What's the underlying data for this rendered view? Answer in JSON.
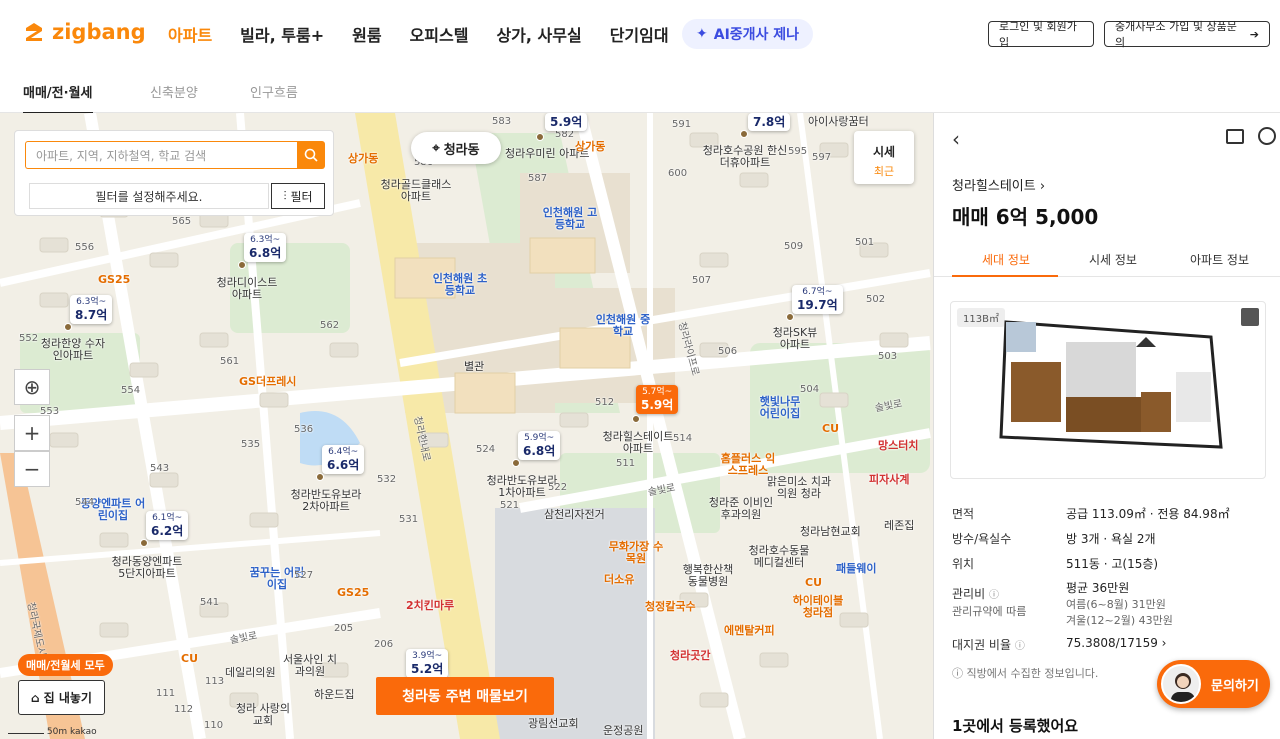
{
  "header": {
    "logo": "zigbang",
    "nav": [
      "아파트",
      "빌라, 투룸+",
      "원룸",
      "오피스텔",
      "상가, 사무실",
      "단기임대"
    ],
    "ai_label": "AI중개사 제나",
    "login_label": "로그인 및 회원가입",
    "agent_label": "중개사무소 가입 및 상품문의"
  },
  "subtabs": [
    "매매/전·월세",
    "신축분양",
    "인구흐름"
  ],
  "search": {
    "placeholder": "아파트, 지역, 지하철역, 학교 검색",
    "filter_msg": "필터를 설정해주세요.",
    "filter_label": "필터"
  },
  "map": {
    "location_label": "청라동",
    "sise_label": "시세",
    "sise_sub": "최근",
    "view_listings_label": "청라동 주변 매물보기",
    "all_badge": "매매/전월세 모두",
    "house_label": "집 내놓기",
    "scale_label": "50m",
    "kakao_label": "kakao",
    "markers": [
      {
        "range": "",
        "price": "5.9억"
      },
      {
        "range": "",
        "price": "7.8억"
      },
      {
        "range": "6.3억~",
        "price": "6.8억"
      },
      {
        "range": "6.3억~",
        "price": "8.7억"
      },
      {
        "range": "6.7억~",
        "price": "19.7억"
      },
      {
        "range": "5.7억~",
        "price": "5.9억"
      },
      {
        "range": "5.9억~",
        "price": "6.8억"
      },
      {
        "range": "6.4억~",
        "price": "6.6억"
      },
      {
        "range": "6.1억~",
        "price": "6.2억"
      },
      {
        "range": "3.9억~",
        "price": "5.2억"
      }
    ],
    "labels": [
      "청라우미린 아파트",
      "청라호수공원 한신더휴아파트",
      "아이사랑꿈터",
      "청라골드클래스 아파트",
      "인천해원 고등학교",
      "청라디이스트 아파트",
      "인천해원 초등학교",
      "인천해원 중학교",
      "청라한양 수자인아파트",
      "청라SK뷰 아파트",
      "GS더프레시",
      "GS25",
      "햇빛나무 어린이집",
      "청라힐스테이트 아파트",
      "청라반도유보라 1차아파트",
      "청라반도유보라 2차아파트",
      "삼천리자전거",
      "동양엔파트 어린이집",
      "청라동양엔파트 5단지아파트",
      "꿈꾸는 어린이집",
      "홈플러스 익스프레스",
      "맑은미소 치과의원 청라",
      "청라준 이비인후과의원",
      "청라남현교회",
      "무화가장 수목원",
      "행복한산책 동물병원",
      "청라호수동물 메디컬센터",
      "더소유",
      "패들웨이",
      "하이테이블 청라점",
      "청정칼국수",
      "에멘탈커피",
      "청라곳간",
      "2치킨마루",
      "GS25",
      "CU",
      "데일리의원",
      "서울사인 치과의원",
      "하운드집",
      "청라 사랑의교회",
      "광림선교회",
      "운정공원",
      "망스터치",
      "피자사계",
      "레존집",
      "상가동",
      "상가동",
      "별관",
      "CU",
      "CU",
      "청라라이프로",
      "청라한내로",
      "솔빛로",
      "솔빛로",
      "솔빛로",
      "청라국제도시로"
    ],
    "numbers": [
      "583",
      "595",
      "597",
      "600",
      "565",
      "556",
      "562",
      "561",
      "552",
      "554",
      "553",
      "535",
      "536",
      "543",
      "544",
      "532",
      "531",
      "541",
      "527",
      "205",
      "206",
      "113",
      "112",
      "111",
      "110",
      "509",
      "501",
      "507",
      "502",
      "506",
      "503",
      "504",
      "512",
      "511",
      "514",
      "524",
      "521",
      "522",
      "586",
      "587",
      "591",
      "582"
    ]
  },
  "panel": {
    "complex": "청라힐스테이트",
    "price": "매매 6억 5,000",
    "tabs": [
      "세대 정보",
      "시세 정보",
      "아파트 정보"
    ],
    "floor_tag": "113B㎡",
    "info": {
      "area_label": "면적",
      "area_val": "공급 113.09㎡ · 전용 84.98㎡",
      "rooms_label": "방수/욕실수",
      "rooms_val": "방 3개 · 욕실 2개",
      "loc_label": "위치",
      "loc_val": "511동 · 고(15층)",
      "fee_label": "관리비",
      "fee_sub": "관리규약에 따름",
      "fee_val": "평균 36만원",
      "fee_summer": "여름(6~8월) 31만원",
      "fee_winter": "겨울(12~2월) 43만원",
      "land_label": "대지권 비율",
      "land_val": "75.3808/17159"
    },
    "note": "ⓘ 직방에서 수집한 정보입니다.",
    "bottom": "1곳에서 등록했어요",
    "inquiry": "문의하기"
  },
  "colors": {
    "accent": "#FA880B",
    "accent_dark": "#FA6A0B",
    "ai_blue": "#3B4CE0"
  }
}
